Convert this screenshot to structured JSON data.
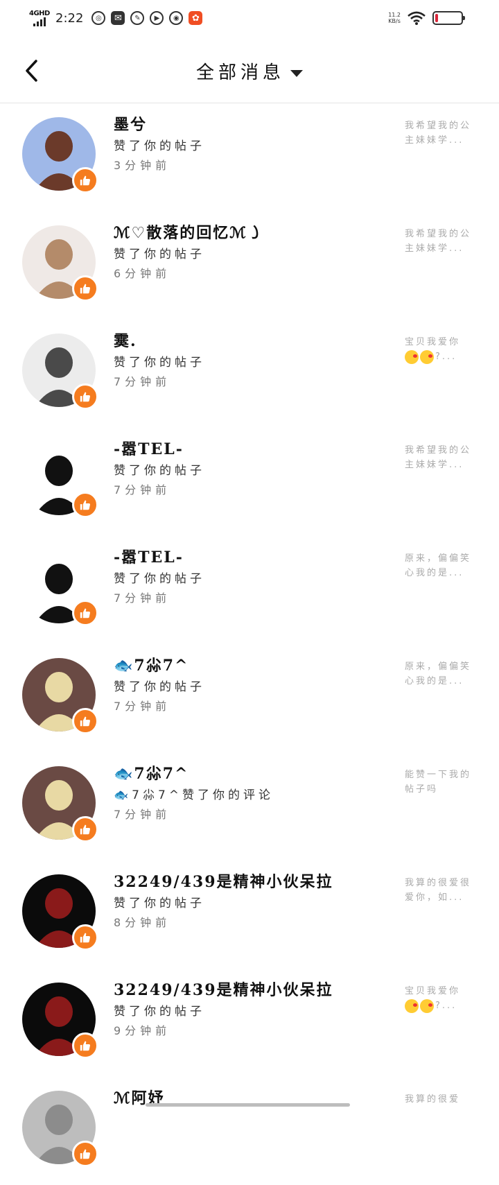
{
  "status_bar": {
    "network": "4GHD",
    "time": "2:22",
    "speed": "11.2",
    "speed_unit": "KB/s",
    "battery": "9",
    "battery_level_percent": 9,
    "app_icons": [
      "netease-music-icon",
      "mail-icon",
      "feather-icon",
      "play-icon",
      "wechat-icon",
      "app-icon"
    ]
  },
  "header": {
    "title": "全部消息",
    "back_icon": "chevron-left-icon",
    "dropdown_icon": "caret-down-icon"
  },
  "colors": {
    "badge": "#f57c1f",
    "divider": "#e4e4e4",
    "battery": "#d9263a"
  },
  "messages": [
    {
      "name": "墨兮",
      "action": "赞了你的帖子",
      "time": "3分钟前",
      "preview": "我希望我的公主妹妹学...",
      "avatar_bg": "#9fb8e8",
      "avatar_fg": "#6b3a2a"
    },
    {
      "name": "ℳ♡散落的回忆ℳ㇁",
      "action": "赞了你的帖子",
      "time": "6分钟前",
      "preview": "我希望我的公主妹妹学...",
      "avatar_bg": "#efe9e6",
      "avatar_fg": "#b48b6a"
    },
    {
      "name": "霙.",
      "action": "赞了你的帖子",
      "time": "7分钟前",
      "preview": "宝贝我爱你",
      "preview_emoji": true,
      "preview_suffix": "?...",
      "avatar_bg": "#ececec",
      "avatar_fg": "#4a4a4a"
    },
    {
      "name": "-嚣TEL-",
      "action": "赞了你的帖子",
      "time": "7分钟前",
      "preview": "我希望我的公主妹妹学...",
      "avatar_bg": "#ffffff",
      "avatar_fg": "#111111"
    },
    {
      "name": "-嚣TEL-",
      "action": "赞了你的帖子",
      "time": "7分钟前",
      "preview": "原来，偏偏笑心我的是...",
      "avatar_bg": "#ffffff",
      "avatar_fg": "#111111"
    },
    {
      "name": "🐟7尛7^",
      "action": "赞了你的帖子",
      "time": "7分钟前",
      "preview": "原来，偏偏笑心我的是...",
      "avatar_bg": "#6a4a44",
      "avatar_fg": "#e8d9a4"
    },
    {
      "name": "🐟7尛7^",
      "action": "🐟7尛7^赞了你的评论",
      "time": "7分钟前",
      "preview": "能赞一下我的帖子吗",
      "avatar_bg": "#6a4a44",
      "avatar_fg": "#e8d9a4"
    },
    {
      "name": "32249/439是精神小伙呆拉",
      "action": "赞了你的帖子",
      "time": "8分钟前",
      "preview": "我算的很爱很爱你，如...",
      "avatar_bg": "#0b0b0b",
      "avatar_fg": "#8a1a1a"
    },
    {
      "name": "32249/439是精神小伙呆拉",
      "action": "赞了你的帖子",
      "time": "9分钟前",
      "preview": "宝贝我爱你",
      "preview_emoji": true,
      "preview_suffix": "?...",
      "avatar_bg": "#0b0b0b",
      "avatar_fg": "#8a1a1a"
    },
    {
      "name": "ℳ阿妤",
      "action": "",
      "time": "",
      "preview": "我算的很爱",
      "avatar_bg": "#bdbdbd",
      "avatar_fg": "#8c8c8c"
    }
  ]
}
